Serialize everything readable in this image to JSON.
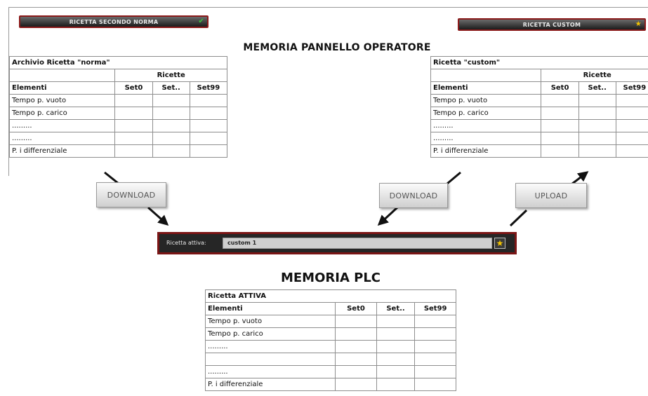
{
  "operator_panel": {
    "title": "MEMORIA PANNELLO OPERATORE",
    "btn_norm": "RICETTA SECONDO NORMA",
    "btn_norm_icon": "green-check-icon",
    "btn_custom": "RICETTA CUSTOM",
    "btn_custom_icon": "yellow-star-icon"
  },
  "norm_table": {
    "caption": "Archivio Ricetta \"norma\"",
    "group_header": "Ricette",
    "header": [
      "Elementi",
      "Set0",
      "Set..",
      "Set99"
    ],
    "rows": [
      "Tempo p. vuoto",
      "Tempo p. carico",
      ".........",
      ".........",
      "P. i differenziale"
    ]
  },
  "custom_table": {
    "caption": "Ricetta \"custom\"",
    "group_header": "Ricette",
    "header": [
      "Elementi",
      "Set0",
      "Set..",
      "Set99"
    ],
    "rows": [
      "Tempo p. vuoto",
      "Tempo p. carico",
      ".........",
      ".........",
      "P. i differenziale"
    ]
  },
  "buttons": {
    "download_left": "DOWNLOAD",
    "download_right": "DOWNLOAD",
    "upload": "UPLOAD"
  },
  "active_panel": {
    "label": "Ricetta attiva:",
    "value": "custom 1",
    "icon": "star-icon"
  },
  "plc": {
    "title": "MEMORIA PLC",
    "caption": "Ricetta ATTIVA",
    "header": [
      "Elementi",
      "Set0",
      "Set..",
      "Set99"
    ],
    "rows": [
      "Tempo p. vuoto",
      "Tempo p. carico",
      ".........",
      "",
      ".........",
      "P. i differenziale"
    ]
  },
  "colors": {
    "button_border": "#8b1a1a",
    "star": "#f4c400",
    "check": "#3cc43c"
  }
}
